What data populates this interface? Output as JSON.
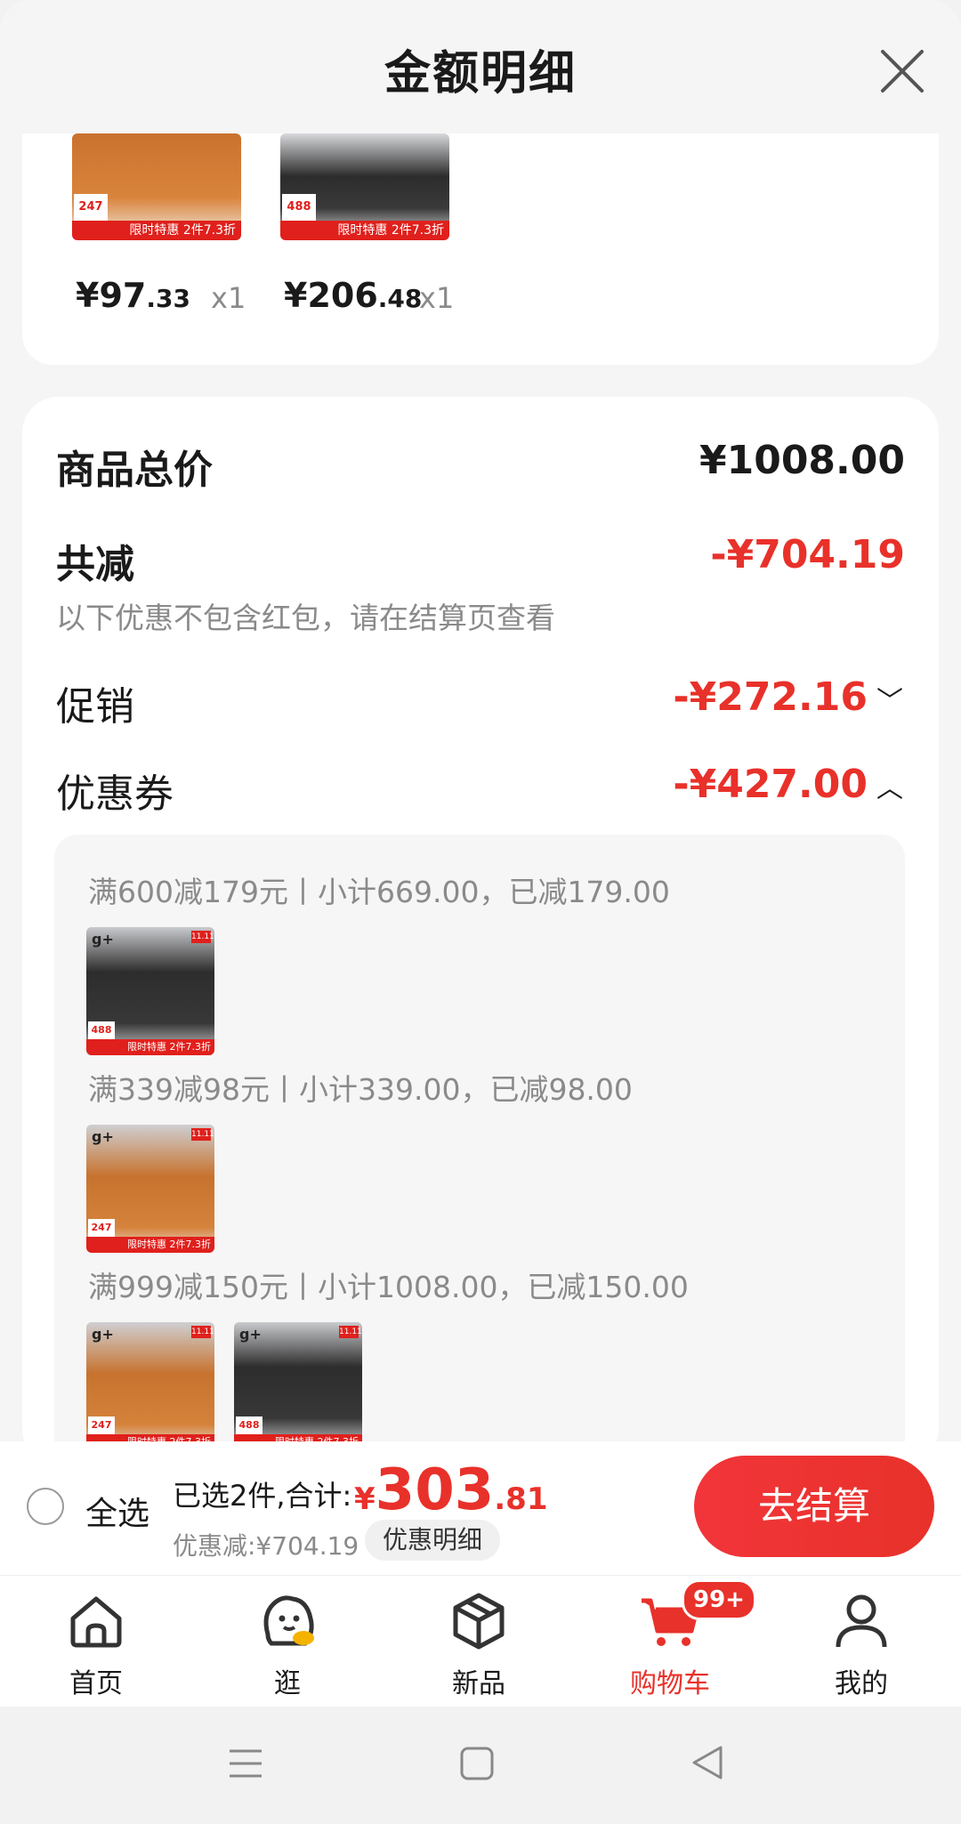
{
  "header": {
    "title": "金额明细"
  },
  "products": [
    {
      "price_int": "¥97",
      "price_dec": ".33",
      "qty": "x1",
      "tag": "247",
      "banner": "限时特惠 2件7.3折"
    },
    {
      "price_int": "¥206",
      "price_dec": ".48",
      "qty": "x1",
      "tag": "488",
      "banner": "限时特惠 2件7.3折"
    }
  ],
  "summary": {
    "total_label": "商品总价",
    "total_value": "¥1008.00",
    "reduce_label": "共减",
    "reduce_value": "-¥704.19",
    "reduce_note": "以下优惠不包含红包，请在结算页查看",
    "promo_label": "促销",
    "promo_value": "-¥272.16",
    "coupon_label": "优惠券",
    "coupon_value": "-¥427.00"
  },
  "coupons": [
    {
      "text": "满600减179元丨小计669.00，已减179.00"
    },
    {
      "text": "满339减98元丨小计339.00，已减98.00"
    },
    {
      "text": "满999减150元丨小计1008.00，已减150.00"
    }
  ],
  "coupon_thumbs": {
    "logo": "g+",
    "badge": "11.11",
    "banner": "限时特惠 2件7.3折",
    "tag_coat": "488",
    "tag_sweater": "247"
  },
  "checkout": {
    "select_all": "全选",
    "selected_info": "已选2件,合计:",
    "total_sym": "¥",
    "total_int": "303",
    "total_dec": ".81",
    "discount": "优惠减:¥704.19",
    "detail_button": "优惠明细",
    "checkout_button": "去结算"
  },
  "tabs": [
    {
      "label": "首页"
    },
    {
      "label": "逛"
    },
    {
      "label": "新品"
    },
    {
      "label": "购物车",
      "badge": "99+"
    },
    {
      "label": "我的"
    }
  ],
  "colors": {
    "accent": "#e8312a",
    "muted": "#8a8a8a"
  }
}
